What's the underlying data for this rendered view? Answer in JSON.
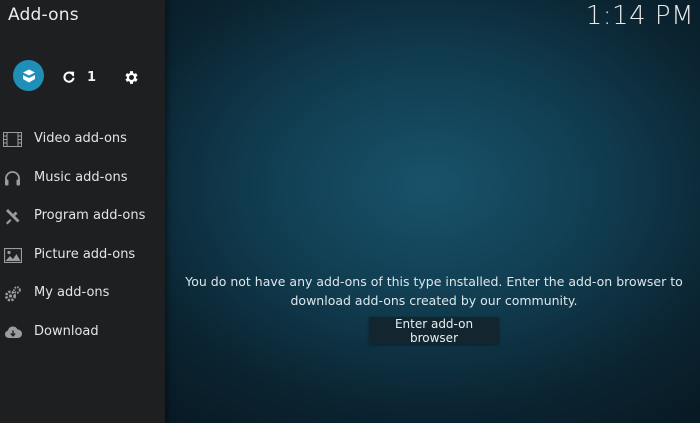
{
  "header": {
    "title": "Add-ons",
    "clock": "1:14 PM"
  },
  "toolbar": {
    "addon_browser_icon": "open-box-icon",
    "update_icon": "refresh-icon",
    "update_count": "1",
    "settings_icon": "gear-icon"
  },
  "sidebar": {
    "items": [
      {
        "label": "Video add-ons",
        "icon": "film-icon"
      },
      {
        "label": "Music add-ons",
        "icon": "headphones-icon"
      },
      {
        "label": "Program add-ons",
        "icon": "tools-icon"
      },
      {
        "label": "Picture add-ons",
        "icon": "picture-icon"
      },
      {
        "label": "My add-ons",
        "icon": "gears-icon"
      },
      {
        "label": "Download",
        "icon": "cloud-download-icon"
      }
    ]
  },
  "main": {
    "message": "You do not have any add-ons of this type installed. Enter the add-on browser to download add-ons created by our community.",
    "enter_browser_label": "Enter add-on browser"
  },
  "colors": {
    "accent": "#1f8fb8",
    "sidebar_bg": "#1d1f21",
    "background": "#103a4d",
    "text": "#e4e4e4"
  }
}
